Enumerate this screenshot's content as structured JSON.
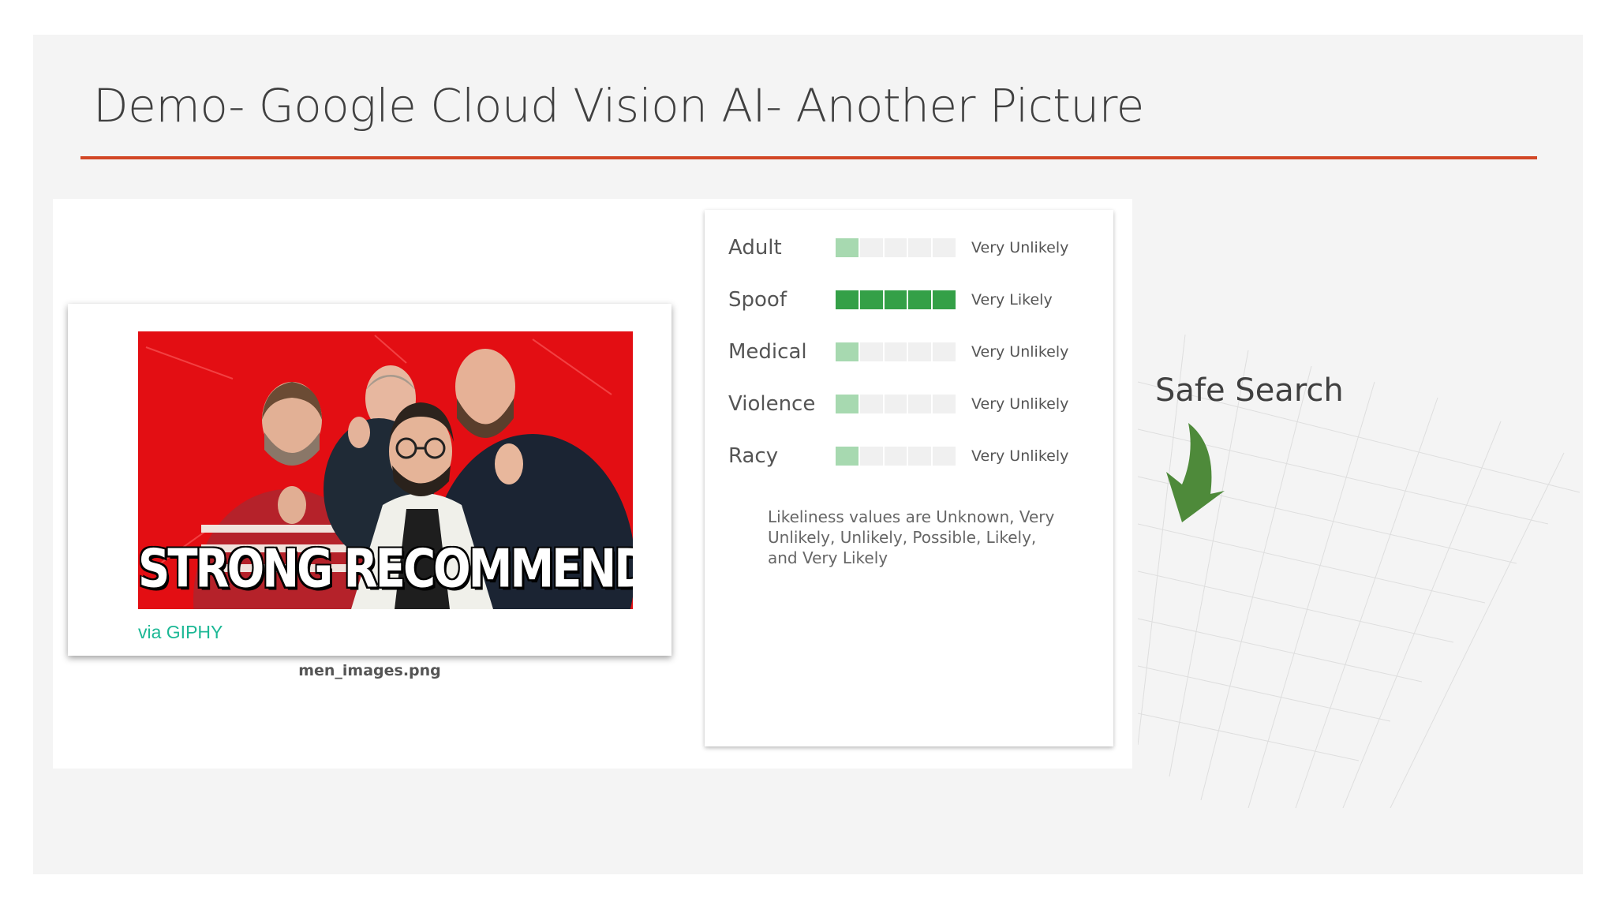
{
  "slide": {
    "title": "Demo- Google Cloud Vision AI- Another Picture",
    "accent_color": "#d24726"
  },
  "image_card": {
    "caption_text": "STRONG RECOMMEND!",
    "credit": "via GIPHY",
    "file_name": "men_images.png"
  },
  "safe_search": {
    "categories": [
      {
        "label": "Adult",
        "likelihood": "Very Unlikely",
        "level": 1
      },
      {
        "label": "Spoof",
        "likelihood": "Very Likely",
        "level": 5
      },
      {
        "label": "Medical",
        "likelihood": "Very Unlikely",
        "level": 1
      },
      {
        "label": "Violence",
        "likelihood": "Very Unlikely",
        "level": 1
      },
      {
        "label": "Racy",
        "likelihood": "Very Unlikely",
        "level": 1
      }
    ],
    "note": "Likeliness values are Unknown, Very Unlikely, Unlikely, Possible, Likely, and Very Likely",
    "colors": {
      "low": "#a7d9b0",
      "high": "#34a047",
      "empty": "#f0f0f0"
    }
  },
  "annotation": {
    "label": "Safe Search",
    "arrow_color": "#4e8a3a",
    "arrow_icon": "curved-down-arrow-icon"
  }
}
